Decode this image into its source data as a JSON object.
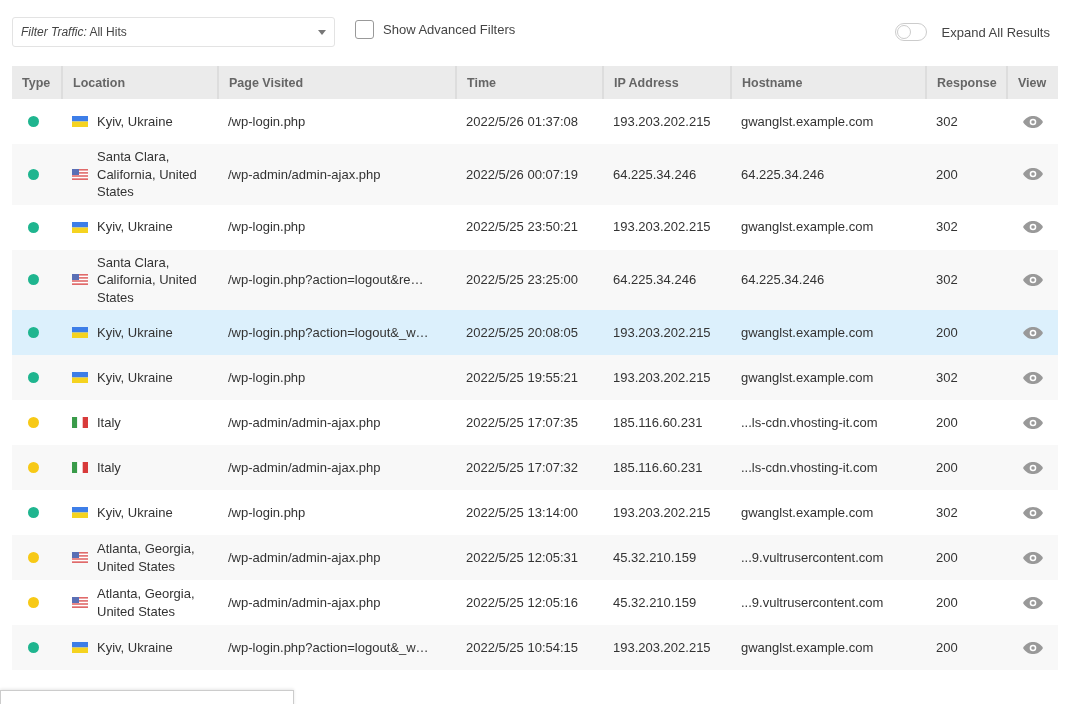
{
  "filter": {
    "label": "Filter Traffic:",
    "value": "All Hits"
  },
  "advanced_filters": {
    "label": "Show Advanced Filters",
    "checked": false
  },
  "expand_all": {
    "label": "Expand All Results",
    "on": false
  },
  "table": {
    "columns": [
      "Type",
      "Location",
      "Page Visited",
      "Time",
      "IP Address",
      "Hostname",
      "Response",
      "View"
    ],
    "rows": [
      {
        "color": "#1fb58f",
        "kind": "ua",
        "location": "Kyiv, Ukraine",
        "page": "/wp-login.php",
        "time": "2022/5/26 01:37:08",
        "ip": "193.203.202.215",
        "hostname": "gwanglst.example.com",
        "response": "302",
        "selected": false
      },
      {
        "color": "#1fb58f",
        "kind": "us",
        "location": "Santa Clara, California, United States",
        "page": "/wp-admin/admin-ajax.php",
        "time": "2022/5/26 00:07:19",
        "ip": "64.225.34.246",
        "hostname": "64.225.34.246",
        "response": "200",
        "selected": false
      },
      {
        "color": "#1fb58f",
        "kind": "ua",
        "location": "Kyiv, Ukraine",
        "page": "/wp-login.php",
        "time": "2022/5/25 23:50:21",
        "ip": "193.203.202.215",
        "hostname": "gwanglst.example.com",
        "response": "302",
        "selected": false
      },
      {
        "color": "#1fb58f",
        "kind": "us",
        "location": "Santa Clara, California, United States",
        "page": "/wp-login.php?action=logout&re…",
        "time": "2022/5/25 23:25:00",
        "ip": "64.225.34.246",
        "hostname": "64.225.34.246",
        "response": "302",
        "selected": false
      },
      {
        "color": "#1fb58f",
        "kind": "ua",
        "location": "Kyiv, Ukraine",
        "page": "/wp-login.php?action=logout&_w…",
        "time": "2022/5/25 20:08:05",
        "ip": "193.203.202.215",
        "hostname": "gwanglst.example.com",
        "response": "200",
        "selected": true
      },
      {
        "color": "#1fb58f",
        "kind": "ua",
        "location": "Kyiv, Ukraine",
        "page": "/wp-login.php",
        "time": "2022/5/25 19:55:21",
        "ip": "193.203.202.215",
        "hostname": "gwanglst.example.com",
        "response": "302",
        "selected": false
      },
      {
        "color": "#f7c916",
        "kind": "it",
        "location": "Italy",
        "page": "/wp-admin/admin-ajax.php",
        "time": "2022/5/25 17:07:35",
        "ip": "185.116.60.231",
        "hostname": "...ls-cdn.vhosting-it.com",
        "response": "200",
        "selected": false
      },
      {
        "color": "#f7c916",
        "kind": "it",
        "location": "Italy",
        "page": "/wp-admin/admin-ajax.php",
        "time": "2022/5/25 17:07:32",
        "ip": "185.116.60.231",
        "hostname": "...ls-cdn.vhosting-it.com",
        "response": "200",
        "selected": false
      },
      {
        "color": "#1fb58f",
        "kind": "ua",
        "location": "Kyiv, Ukraine",
        "page": "/wp-login.php",
        "time": "2022/5/25 13:14:00",
        "ip": "193.203.202.215",
        "hostname": "gwanglst.example.com",
        "response": "302",
        "selected": false
      },
      {
        "color": "#f7c916",
        "kind": "us",
        "location": "Atlanta, Georgia, United States",
        "page": "/wp-admin/admin-ajax.php",
        "time": "2022/5/25 12:05:31",
        "ip": "45.32.210.159",
        "hostname": "...9.vultrusercontent.com",
        "response": "200",
        "selected": false
      },
      {
        "color": "#f7c916",
        "kind": "us",
        "location": "Atlanta, Georgia, United States",
        "page": "/wp-admin/admin-ajax.php",
        "time": "2022/5/25 12:05:16",
        "ip": "45.32.210.159",
        "hostname": "...9.vultrusercontent.com",
        "response": "200",
        "selected": false
      },
      {
        "color": "#1fb58f",
        "kind": "ua",
        "location": "Kyiv, Ukraine",
        "page": "/wp-login.php?action=logout&_w…",
        "time": "2022/5/25 10:54:15",
        "ip": "193.203.202.215",
        "hostname": "gwanglst.example.com",
        "response": "200",
        "selected": false
      }
    ]
  }
}
